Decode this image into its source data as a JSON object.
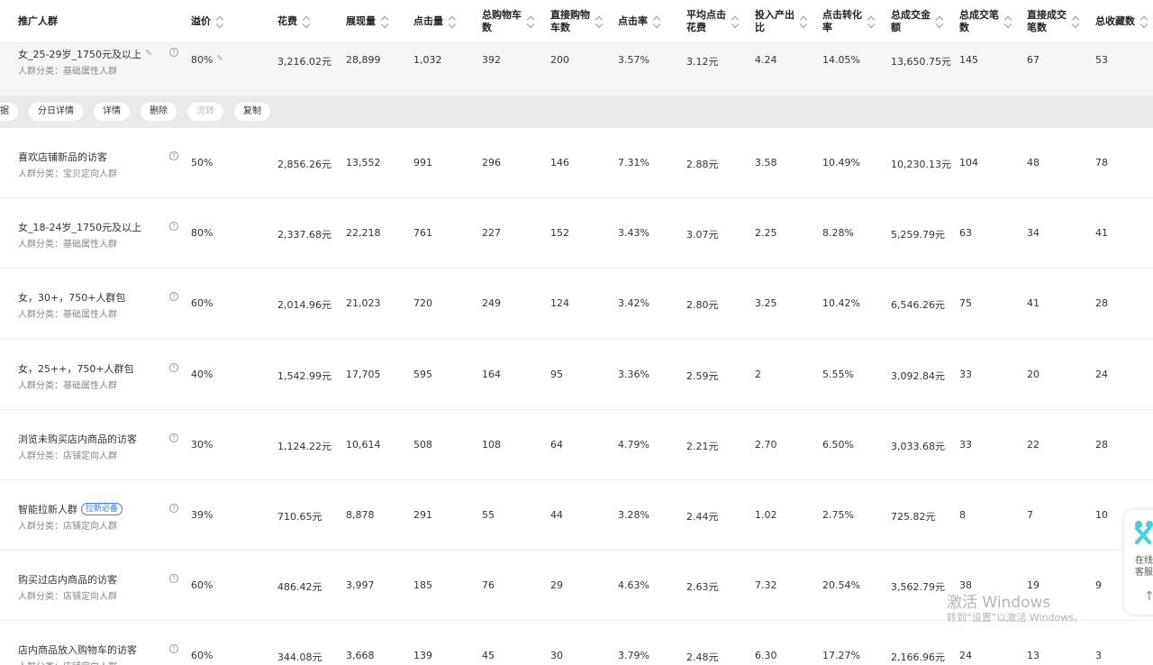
{
  "columns": [
    {
      "key": "name",
      "label": "推广人群",
      "sortable": false
    },
    {
      "key": "premium",
      "label": "溢价",
      "sortable": true
    },
    {
      "key": "cost",
      "label": "花费",
      "sortable": true
    },
    {
      "key": "impressions",
      "label": "展现量",
      "sortable": true
    },
    {
      "key": "clicks",
      "label": "点击量",
      "sortable": true
    },
    {
      "key": "cart_total",
      "label": "总购物车\n数",
      "sortable": true
    },
    {
      "key": "cart_direct",
      "label": "直接购物\n车数",
      "sortable": true
    },
    {
      "key": "ctr",
      "label": "点击率",
      "sortable": true
    },
    {
      "key": "cpc",
      "label": "平均点击\n花费",
      "sortable": true
    },
    {
      "key": "roi",
      "label": "投入产出\n比",
      "sortable": true
    },
    {
      "key": "cvr",
      "label": "点击转化\n率",
      "sortable": true
    },
    {
      "key": "gmv",
      "label": "总成交金\n额",
      "sortable": true
    },
    {
      "key": "orders_total",
      "label": "总成交笔\n数",
      "sortable": true
    },
    {
      "key": "orders_direct",
      "label": "直接成交\n笔数",
      "sortable": true
    },
    {
      "key": "favorites",
      "label": "总收藏数",
      "sortable": true
    }
  ],
  "rows": [
    {
      "name": "女_25-29岁_1750元及以上",
      "category": "人群分类：基础属性人群",
      "premium": "80%",
      "cost": "3,216.02元",
      "impressions": "28,899",
      "clicks": "1,032",
      "cart_total": "392",
      "cart_direct": "200",
      "ctr": "3.57%",
      "cpc": "3.12元",
      "roi": "4.24",
      "cvr": "14.05%",
      "gmv": "13,650.75元",
      "orders_total": "145",
      "orders_direct": "67",
      "favorites": "53",
      "tag": ""
    },
    {
      "name": "喜欢店铺新品的访客",
      "category": "人群分类：宝贝定向人群",
      "premium": "50%",
      "cost": "2,856.26元",
      "impressions": "13,552",
      "clicks": "991",
      "cart_total": "296",
      "cart_direct": "146",
      "ctr": "7.31%",
      "cpc": "2.88元",
      "roi": "3.58",
      "cvr": "10.49%",
      "gmv": "10,230.13元",
      "orders_total": "104",
      "orders_direct": "48",
      "favorites": "78",
      "tag": ""
    },
    {
      "name": "女_18-24岁_1750元及以上",
      "category": "人群分类：基础属性人群",
      "premium": "80%",
      "cost": "2,337.68元",
      "impressions": "22,218",
      "clicks": "761",
      "cart_total": "227",
      "cart_direct": "152",
      "ctr": "3.43%",
      "cpc": "3.07元",
      "roi": "2.25",
      "cvr": "8.28%",
      "gmv": "5,259.79元",
      "orders_total": "63",
      "orders_direct": "34",
      "favorites": "41",
      "tag": ""
    },
    {
      "name": "女，30+，750+人群包",
      "category": "人群分类：基础属性人群",
      "premium": "60%",
      "cost": "2,014.96元",
      "impressions": "21,023",
      "clicks": "720",
      "cart_total": "249",
      "cart_direct": "124",
      "ctr": "3.42%",
      "cpc": "2.80元",
      "roi": "3.25",
      "cvr": "10.42%",
      "gmv": "6,546.26元",
      "orders_total": "75",
      "orders_direct": "41",
      "favorites": "28",
      "tag": ""
    },
    {
      "name": "女，25++，750+人群包",
      "category": "人群分类：基础属性人群",
      "premium": "40%",
      "cost": "1,542.99元",
      "impressions": "17,705",
      "clicks": "595",
      "cart_total": "164",
      "cart_direct": "95",
      "ctr": "3.36%",
      "cpc": "2.59元",
      "roi": "2",
      "cvr": "5.55%",
      "gmv": "3,092.84元",
      "orders_total": "33",
      "orders_direct": "20",
      "favorites": "24",
      "tag": ""
    },
    {
      "name": "浏览未购买店内商品的访客",
      "category": "人群分类：店铺定向人群",
      "premium": "30%",
      "cost": "1,124.22元",
      "impressions": "10,614",
      "clicks": "508",
      "cart_total": "108",
      "cart_direct": "64",
      "ctr": "4.79%",
      "cpc": "2.21元",
      "roi": "2.70",
      "cvr": "6.50%",
      "gmv": "3,033.68元",
      "orders_total": "33",
      "orders_direct": "22",
      "favorites": "28",
      "tag": ""
    },
    {
      "name": "智能拉新人群",
      "category": "人群分类：店铺定向人群",
      "premium": "39%",
      "cost": "710.65元",
      "impressions": "8,878",
      "clicks": "291",
      "cart_total": "55",
      "cart_direct": "44",
      "ctr": "3.28%",
      "cpc": "2.44元",
      "roi": "1.02",
      "cvr": "2.75%",
      "gmv": "725.82元",
      "orders_total": "8",
      "orders_direct": "7",
      "favorites": "10",
      "tag": "拉新必备"
    },
    {
      "name": "购买过店内商品的访客",
      "category": "人群分类：店铺定向人群",
      "premium": "60%",
      "cost": "486.42元",
      "impressions": "3,997",
      "clicks": "185",
      "cart_total": "76",
      "cart_direct": "29",
      "ctr": "4.63%",
      "cpc": "2.63元",
      "roi": "7.32",
      "cvr": "20.54%",
      "gmv": "3,562.79元",
      "orders_total": "38",
      "orders_direct": "19",
      "favorites": "9",
      "tag": ""
    },
    {
      "name": "店内商品放入购物车的访客",
      "category": "人群分类：店铺定向人群",
      "premium": "60%",
      "cost": "344.08元",
      "impressions": "3,668",
      "clicks": "139",
      "cart_total": "45",
      "cart_direct": "30",
      "ctr": "3.79%",
      "cpc": "2.48元",
      "roi": "6.30",
      "cvr": "17.27%",
      "gmv": "2,166.96元",
      "orders_total": "24",
      "orders_direct": "13",
      "favorites": "3",
      "tag": ""
    }
  ],
  "actions": [
    {
      "label": "据",
      "disabled": false
    },
    {
      "label": "分日详情",
      "disabled": false
    },
    {
      "label": "详情",
      "disabled": false
    },
    {
      "label": "删除",
      "disabled": false
    },
    {
      "label": "流转",
      "disabled": true
    },
    {
      "label": "复制",
      "disabled": false
    }
  ],
  "float_panel": {
    "label": "在线\n客服",
    "top_arrow": "↑"
  },
  "watermark": {
    "title": "激活 Windows",
    "subtitle": "转到“设置”以激活 Windows。"
  },
  "colors": {
    "accent": "#3b7cf6",
    "selected_row_bg": "#f5f6f8",
    "action_bar_bg": "#e8e9eb"
  }
}
